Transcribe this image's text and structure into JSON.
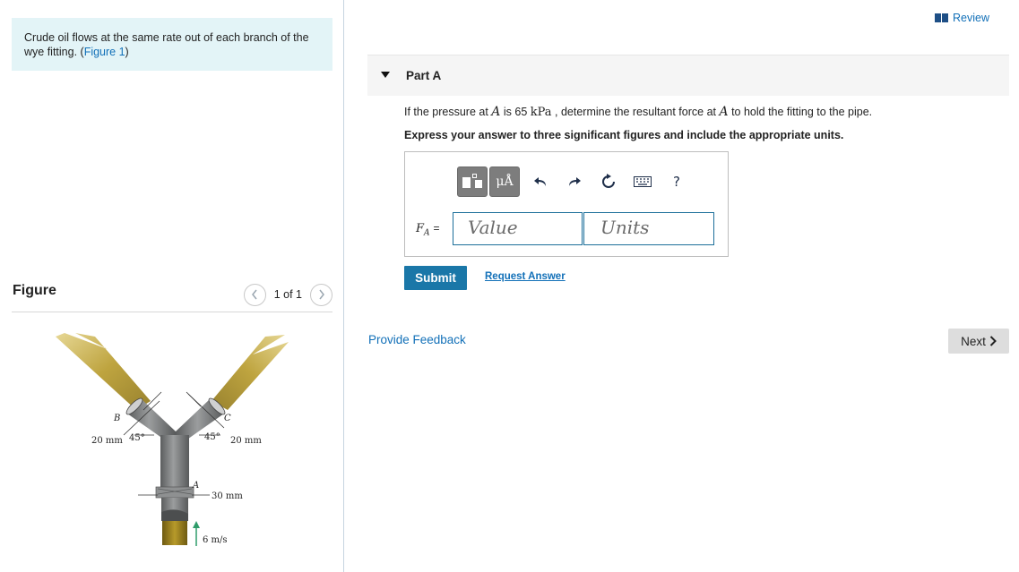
{
  "intro": {
    "text": "Crude oil flows at the same rate out of each branch of the wye fitting. (",
    "link": "Figure 1",
    "close": ")"
  },
  "figure": {
    "title": "Figure",
    "pager_text": "1 of 1",
    "prev_icon": "chevron-left-icon",
    "next_icon": "chevron-right-icon",
    "labels": {
      "b": "B",
      "c": "C",
      "a": "A",
      "left_diam": "20 mm",
      "right_diam": "20 mm",
      "left_angle": "45°",
      "right_angle": "45°",
      "main_diam": "30 mm",
      "velocity": "6 m/s"
    },
    "colors": {
      "pipe": "#7d7f80",
      "oil": "#b79a2a"
    }
  },
  "header": {
    "review": "Review"
  },
  "part": {
    "title": "Part A",
    "q1": "If the pressure at ",
    "qA": "A",
    "q2": " is 65 ",
    "qunit": "kPa",
    "q3": " , determine the resultant force at ",
    "qA2": "A",
    "q4": " to hold the fitting to the pipe.",
    "instruction": "Express your answer to three significant figures and include the appropriate units."
  },
  "toolbar": {
    "template": "templates-icon",
    "mu": "μÅ",
    "undo": "undo-icon",
    "redo": "redo-icon",
    "reset": "reset-icon",
    "keyboard": "keyboard-icon",
    "help": "?"
  },
  "answer": {
    "var": "F",
    "sub": "A",
    "eq": "=",
    "value_placeholder": "Value",
    "units_placeholder": "Units"
  },
  "actions": {
    "submit": "Submit",
    "request": "Request Answer",
    "feedback": "Provide Feedback",
    "next": "Next"
  },
  "colors": {
    "accent": "#1270b8",
    "submit_bg": "#1a77a8",
    "intro_bg": "#e3f4f7"
  }
}
